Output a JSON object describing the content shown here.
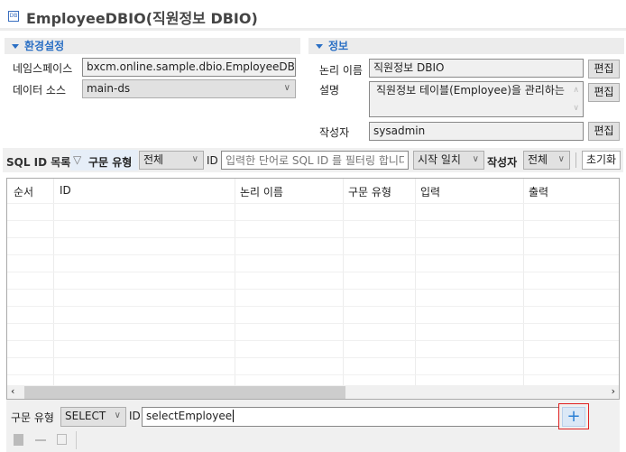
{
  "title": {
    "icon": "dbio-icon",
    "text": "EmployeeDBIO(직원정보 DBIO)",
    "icon_text": "DB"
  },
  "settings": {
    "header": "환경설정",
    "namespace_label": "네임스페이스",
    "namespace_value": "bxcm.online.sample.dbio.EmployeeDBIO",
    "datasource_label": "데이터 소스",
    "datasource_value": "main-ds"
  },
  "info": {
    "header": "정보",
    "logical_name_label": "논리 이름",
    "logical_name_value": "직원정보 DBIO",
    "description_label": "설명",
    "description_value": "직원정보 테이블(Employee)을 관리하는",
    "author_label": "작성자",
    "author_value": "sysadmin",
    "edit_label": "편집"
  },
  "filter": {
    "list_label": "SQL ID 목록",
    "type_label": "구문 유형",
    "type_value": "전체",
    "id_label": "ID",
    "id_placeholder": "입력한 단어로 SQL ID 를 필터링 합니다",
    "match_value": "시작 일치",
    "author_label": "작성자",
    "author_value": "전체",
    "reset_label": "초기화"
  },
  "table": {
    "columns": [
      "순서",
      "ID",
      "논리 이름",
      "구문 유형",
      "입력",
      "출력"
    ],
    "rows": []
  },
  "add": {
    "type_label": "구문 유형",
    "type_value": "SELECT",
    "id_label": "ID",
    "id_value": "selectEmployee",
    "add_icon": "plus-icon"
  },
  "colors": {
    "accent": "#2a6fc4",
    "highlight": "#e02020"
  }
}
